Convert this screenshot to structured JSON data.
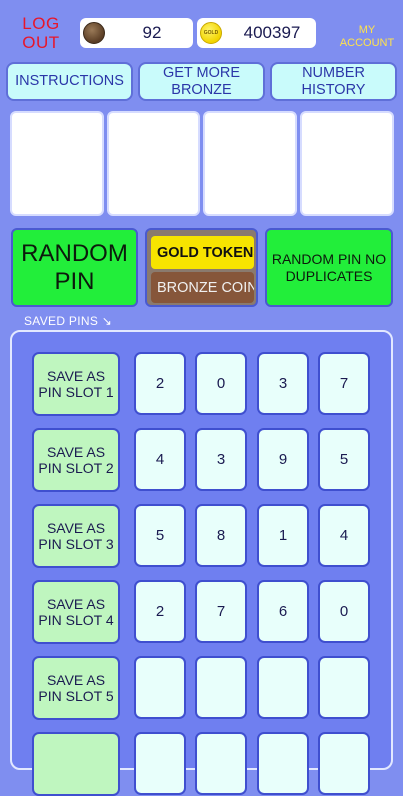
{
  "top": {
    "logout": "LOG OUT",
    "bronze_balance": "92",
    "gold_label": "GOLD",
    "gold_balance": "400397",
    "my_account": "MY ACCOUNT"
  },
  "nav": {
    "instructions": "INSTRUCTIONS",
    "get_more_bronze": "GET MORE BRONZE",
    "number_history": "NUMBER HISTORY"
  },
  "actions": {
    "random_pin": "RANDOM PIN",
    "gold_token": "GOLD TOKENS",
    "bronze_coin": "BRONZE COINS",
    "random_pin_no_dup": "RANDOM PIN NO DUPLICATES"
  },
  "saved_pins_label": "SAVED PINS ↘",
  "slots": [
    {
      "label": "SAVE AS PIN SLOT 1",
      "digits": [
        "2",
        "0",
        "3",
        "7"
      ]
    },
    {
      "label": "SAVE AS PIN SLOT 2",
      "digits": [
        "4",
        "3",
        "9",
        "5"
      ]
    },
    {
      "label": "SAVE AS PIN SLOT 3",
      "digits": [
        "5",
        "8",
        "1",
        "4"
      ]
    },
    {
      "label": "SAVE AS PIN SLOT 4",
      "digits": [
        "2",
        "7",
        "6",
        "0"
      ]
    },
    {
      "label": "SAVE AS PIN SLOT 5",
      "digits": [
        "",
        "",
        "",
        ""
      ]
    },
    {
      "label": "",
      "digits": [
        "",
        "",
        "",
        ""
      ]
    }
  ],
  "colors": {
    "background": "#7f8ef0",
    "logout": "#e8162a",
    "account": "#ffe34a",
    "random_button": "#22ee3a",
    "gold_token": "#f7e400",
    "bronze_coin": "#86563a"
  }
}
